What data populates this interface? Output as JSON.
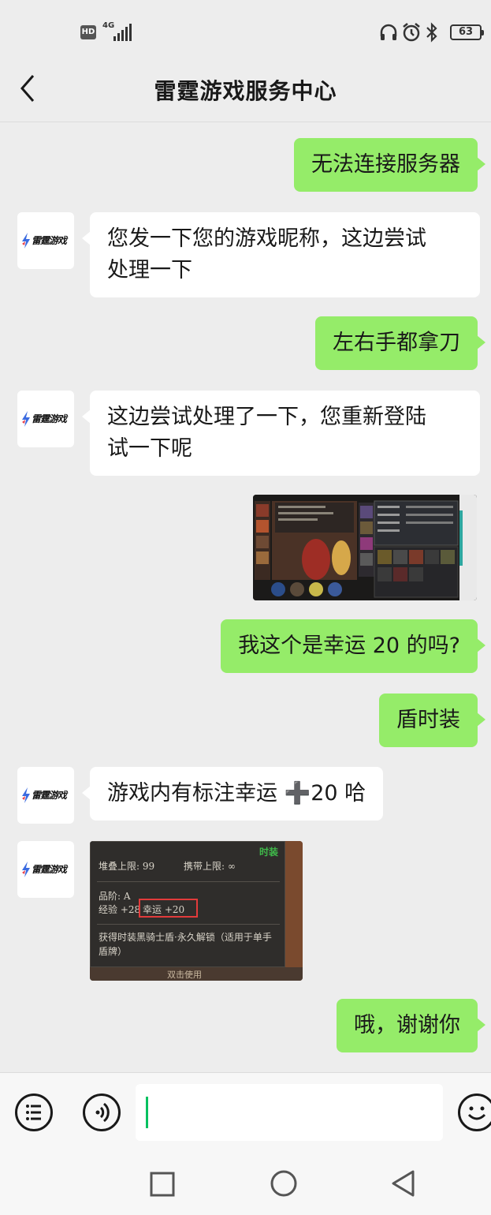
{
  "status_bar": {
    "hd": "HD",
    "network": "4G",
    "battery": "63"
  },
  "header": {
    "title": "雷霆游戏服务中心"
  },
  "contact": {
    "avatar_text": "雷霆游戏"
  },
  "messages": [
    {
      "side": "sent",
      "text": "无法连接服务器"
    },
    {
      "side": "received",
      "text": "您发一下您的游戏昵称，这边尝试\n处理一下"
    },
    {
      "side": "sent",
      "text": "左右手都拿刀"
    },
    {
      "side": "received",
      "text": "这边尝试处理了一下，您重新登陆\n试一下呢"
    },
    {
      "side": "sent",
      "image": "game-screenshot"
    },
    {
      "side": "sent",
      "text": "我这个是幸运 20 的吗?"
    },
    {
      "side": "sent",
      "text": "盾时装"
    },
    {
      "side": "received",
      "text": "游戏内有标注幸运 ➕20 哈"
    },
    {
      "side": "received",
      "image": "item-tooltip-screenshot"
    },
    {
      "side": "sent",
      "text": "哦，谢谢你"
    }
  ],
  "item_tooltip": {
    "tag": "时装",
    "stack_limit": "堆叠上限: 99",
    "carry_limit": "携带上限: ∞",
    "grade": "品阶: A",
    "exp": "经验 +28",
    "luck": "幸运 +20",
    "desc_line1": "获得时装黑骑士盾·永久解锁（适用于单手",
    "desc_line2": "盾牌）",
    "bottom_text": "双击使用"
  },
  "input": {
    "value": ""
  },
  "colors": {
    "sent_bubble": "#95ec69",
    "received_bubble": "#ffffff",
    "background": "#ededed",
    "caret": "#07c160"
  },
  "icons": [
    "back-arrow-icon",
    "menu-list-icon",
    "voice-icon",
    "emoji-icon",
    "nav-recent-icon",
    "nav-home-icon",
    "nav-back-icon",
    "headphones-icon",
    "alarm-icon",
    "bluetooth-icon",
    "battery-icon",
    "signal-icon"
  ]
}
